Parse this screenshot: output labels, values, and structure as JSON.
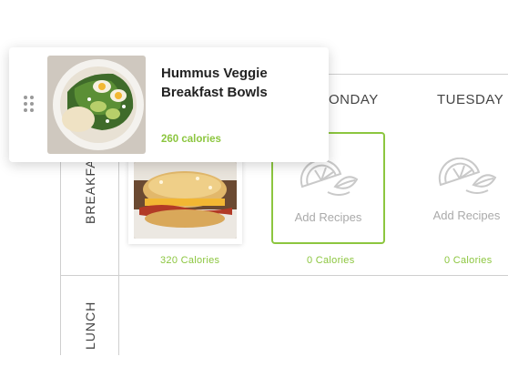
{
  "planner": {
    "days": [
      "MONDAY",
      "TUESDAY"
    ],
    "rows": [
      "BREAKFAST",
      "LUNCH"
    ],
    "breakfast": {
      "slot_monday_label": "Add Recipes",
      "slot_tuesday_label": "Add Recipes",
      "sunday_calories": "320 Calories",
      "monday_calories": "0 Calories",
      "tuesday_calories": "0 Calories"
    }
  },
  "drag_card": {
    "title": "Hummus Veggie Breakfast Bowls",
    "calories": "260 calories"
  },
  "colors": {
    "accent_green": "#8cc63f",
    "grid": "#cfcfcf",
    "muted_text": "#aaaaaa"
  },
  "icons": {
    "drag": "drag-handle-icon",
    "slot": "lemon-slice-icon"
  }
}
